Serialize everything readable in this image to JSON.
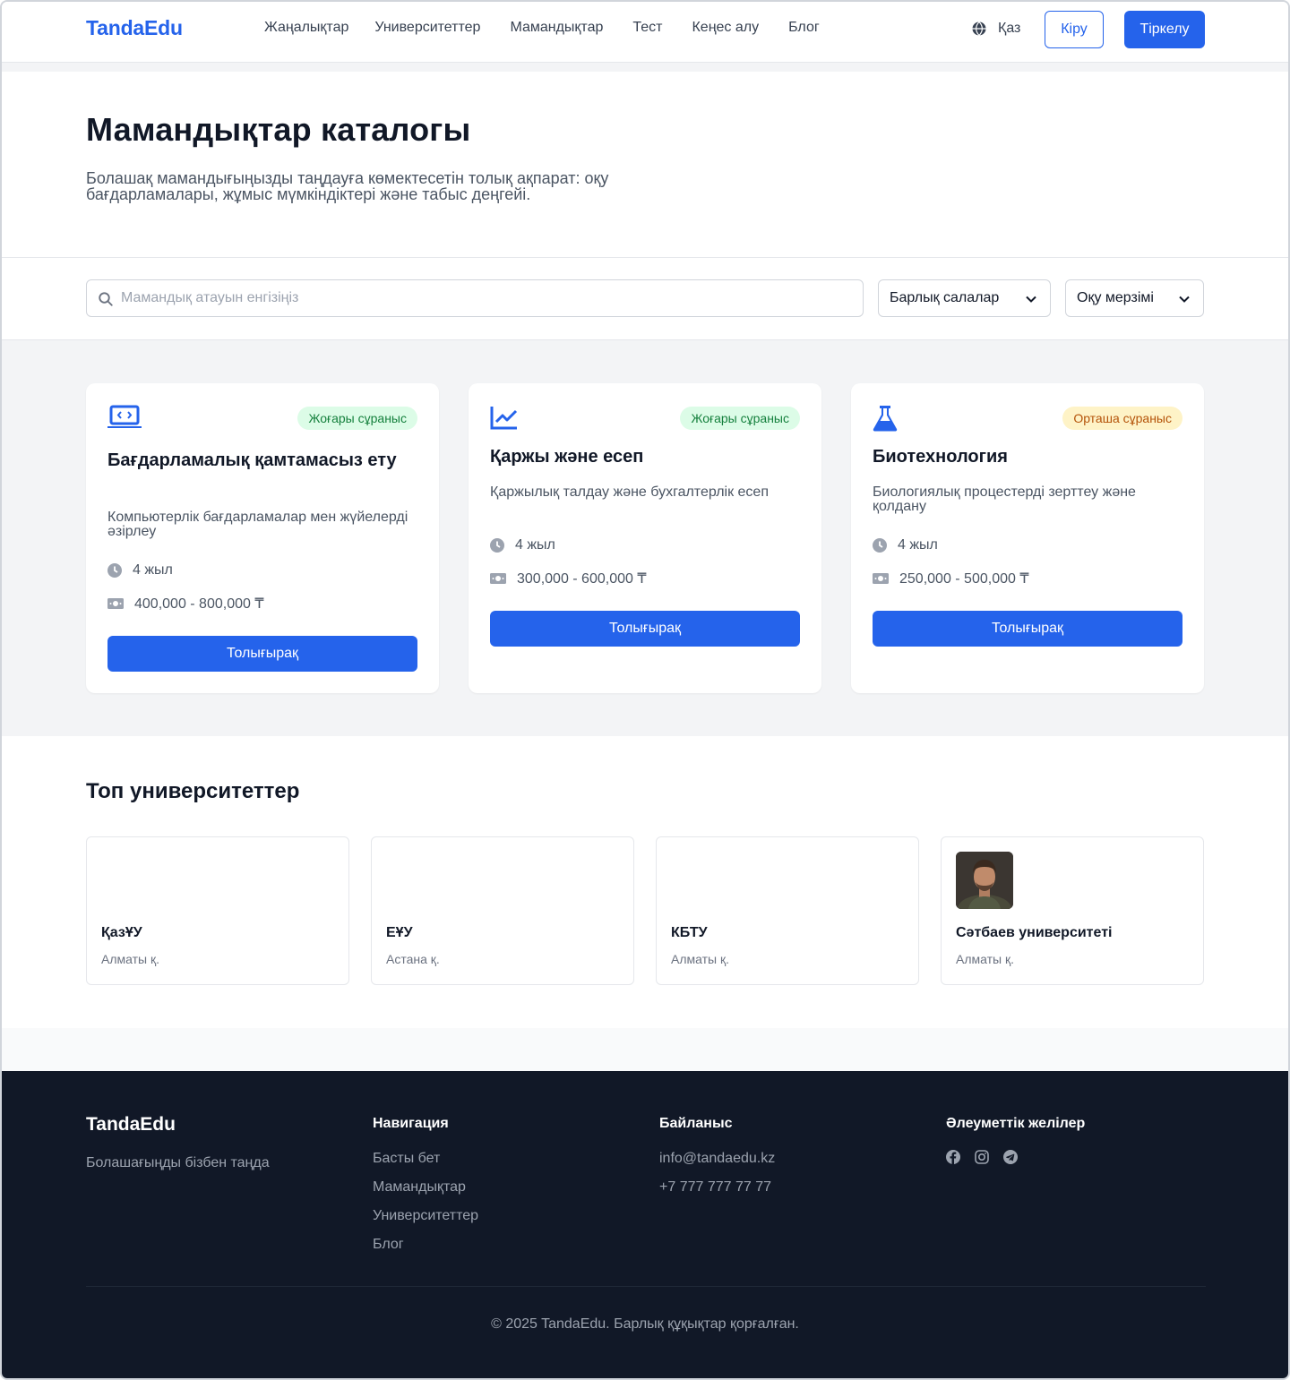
{
  "header": {
    "logo": "TandaEdu",
    "nav": [
      "Жаңалықтар",
      "Университеттер",
      "Мамандықтар",
      "Тест",
      "Кеңес алу",
      "Блог"
    ],
    "language": "Қаз",
    "login": "Кіру",
    "register": "Тіркелу"
  },
  "hero": {
    "title": "Мамандықтар каталогы",
    "subtitle": "Болашақ мамандығыңызды таңдауға көмектесетін толық ақпарат: оқу бағдарламалары, жұмыс мүмкіндіктері және табыс деңгейі."
  },
  "filters": {
    "search_placeholder": "Мамандық атауын енгізіңіз",
    "field_select": "Барлық салалар",
    "duration_select": "Оқу мерзімі"
  },
  "specialties": [
    {
      "icon": "laptop-code-icon",
      "badge": "Жоғары сұраныс",
      "title": "Бағдарламалық қамтамасыз ету",
      "description": "Компьютерлік бағдарламалар мен жүйелерді әзірлеу",
      "duration": "4 жыл",
      "salary": "400,000 - 800,000 ₸",
      "button": "Толығырақ"
    },
    {
      "icon": "chart-line-icon",
      "badge": "Жоғары сұраныс",
      "title": "Қаржы және есеп",
      "description": "Қаржылық талдау және бухгалтерлік есеп",
      "duration": "4 жыл",
      "salary": "300,000 - 600,000 ₸",
      "button": "Толығырақ"
    },
    {
      "icon": "flask-icon",
      "badge": "Орташа сұраныс",
      "title": "Биотехнология",
      "description": "Биологиялық процестерді зерттеу және қолдану",
      "duration": "4 жыл",
      "salary": "250,000 - 500,000 ₸",
      "button": "Толығырақ"
    }
  ],
  "universities": {
    "title": "Топ университеттер",
    "items": [
      {
        "name": "ҚазҰУ",
        "city": "Алматы қ."
      },
      {
        "name": "ЕҰУ",
        "city": "Астана қ."
      },
      {
        "name": "КБТУ",
        "city": "Алматы қ."
      },
      {
        "name": "Сәтбаев университеті",
        "city": "Алматы қ."
      }
    ]
  },
  "footer": {
    "brand": "TandaEdu",
    "tagline": "Болашағыңды бізбен таңда",
    "nav_title": "Навигация",
    "nav_links": [
      "Басты бет",
      "Мамандықтар",
      "Университеттер",
      "Блог"
    ],
    "contact_title": "Байланыс",
    "email": "info@tandaedu.kz",
    "phone": "+7 777 777 77 77",
    "social_title": "Әлеуметтік желілер",
    "socials": [
      "facebook-icon",
      "instagram-icon",
      "telegram-icon"
    ],
    "copyright": "© 2025 TandaEdu. Барлық құқықтар қорғалған."
  },
  "colors": {
    "primary": "#2563eb",
    "dark": "#111827",
    "badge_high_bg": "#dcfce7",
    "badge_mid_bg": "#fef3c7"
  }
}
